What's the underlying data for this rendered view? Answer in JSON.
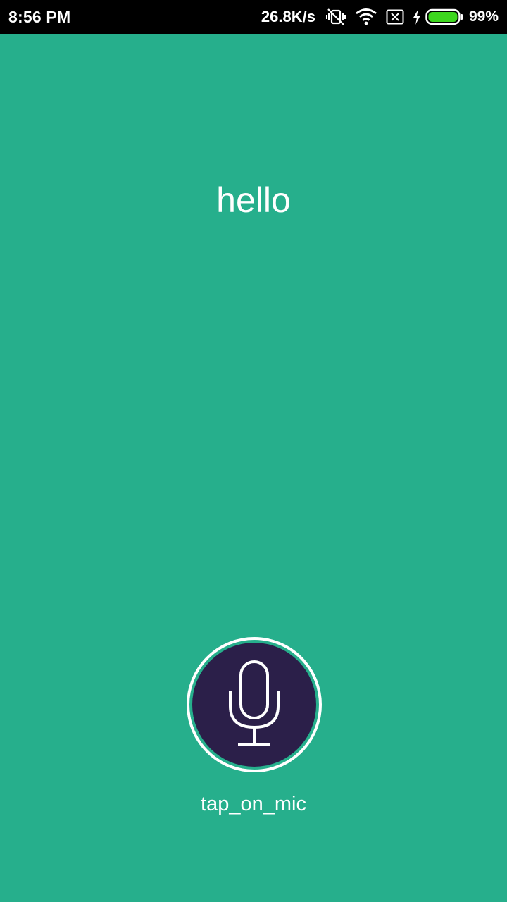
{
  "status_bar": {
    "time": "8:56 PM",
    "net_speed": "26.8K/s",
    "battery_percent": "99%",
    "icons": [
      "vibrate-off-icon",
      "wifi-icon",
      "no-sim-icon",
      "charging-bolt-icon",
      "battery-icon"
    ]
  },
  "main": {
    "greeting_text": "hello",
    "mic_label": "tap_on_mic",
    "mic_icon": "microphone-icon"
  },
  "colors": {
    "background": "#26AF8C",
    "mic_fill": "#2B1F49",
    "status_bar": "#000000",
    "text": "#FFFFFF",
    "battery_fill": "#3DD61E"
  }
}
